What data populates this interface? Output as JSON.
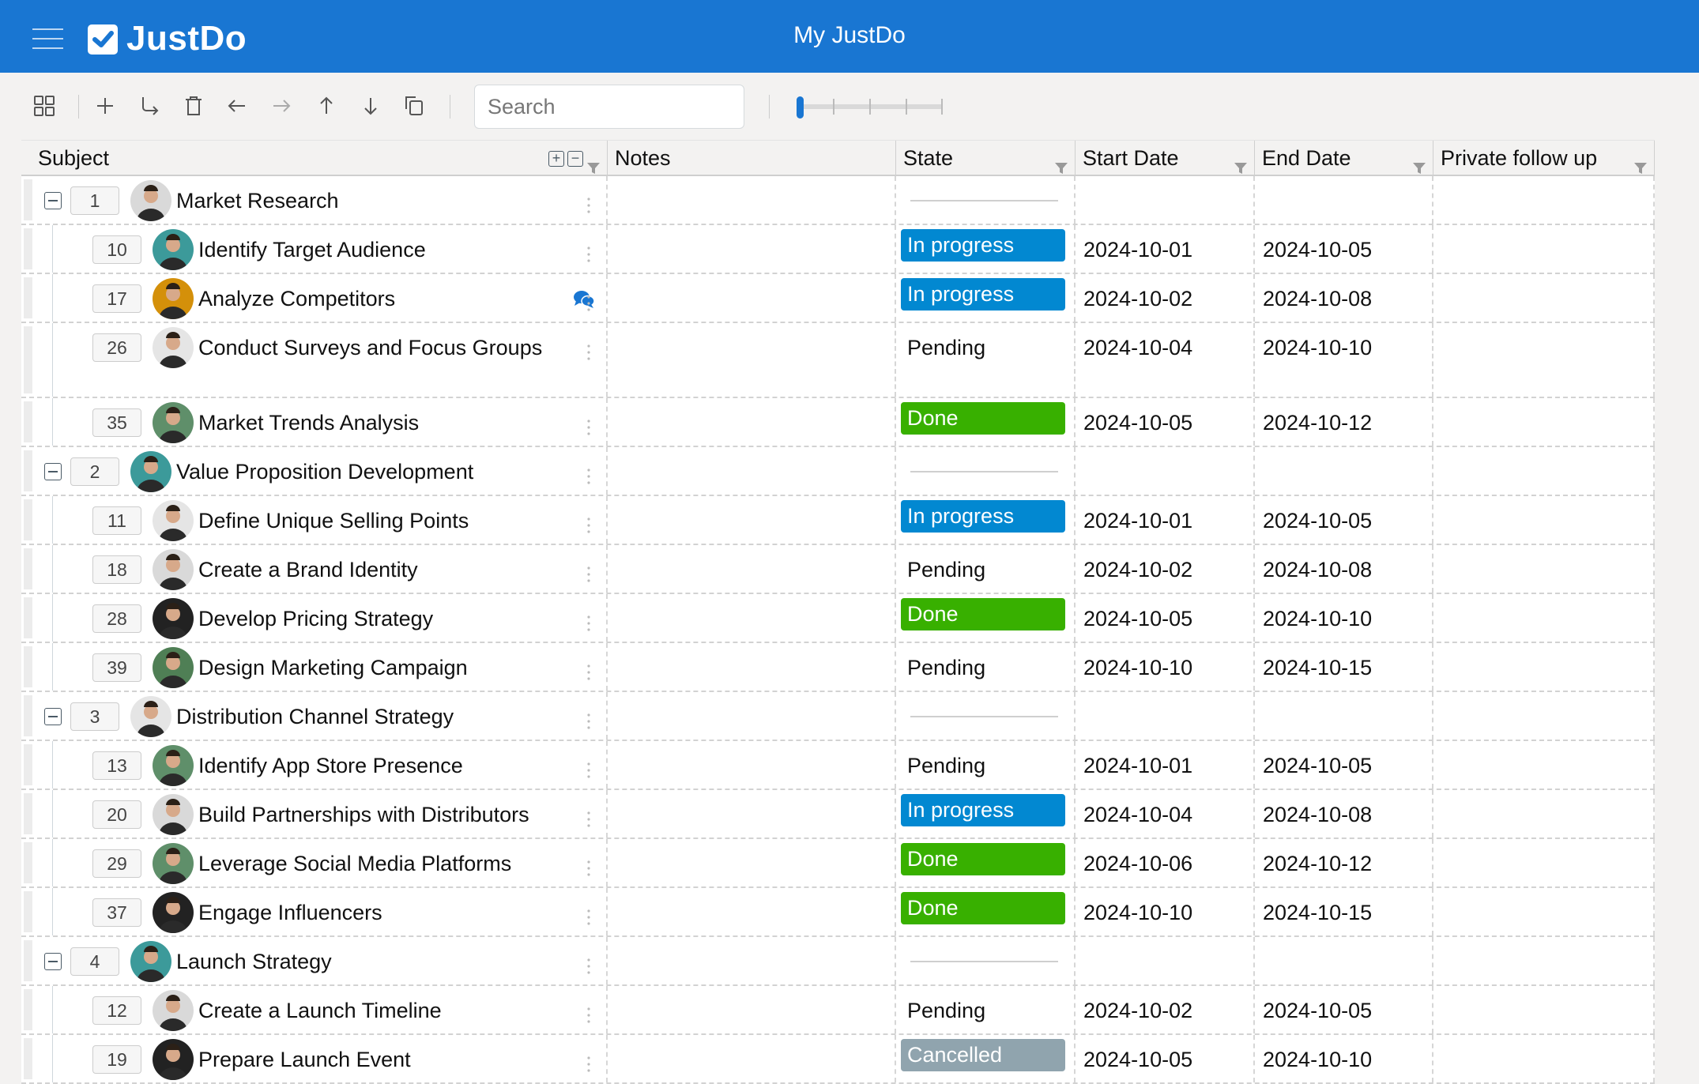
{
  "header": {
    "logo": "JustDo",
    "title": "My JustDo"
  },
  "toolbar": {
    "search_placeholder": "Search"
  },
  "columns": [
    "Subject",
    "Notes",
    "State",
    "Start Date",
    "End Date",
    "Private follow up"
  ],
  "colors": {
    "brand": "#1976d2",
    "In progress": "#0288d1",
    "Done": "#38b000",
    "Cancelled": "#90a4ae"
  },
  "rows": [
    {
      "id": "1",
      "subject": "Market Research",
      "parent": true,
      "avatar": "#d9d9d9"
    },
    {
      "id": "10",
      "subject": "Identify Target Audience",
      "state": "In progress",
      "start": "2024-10-01",
      "end": "2024-10-05",
      "avatar": "#3c9a9a"
    },
    {
      "id": "17",
      "subject": "Analyze Competitors",
      "state": "In progress",
      "start": "2024-10-02",
      "end": "2024-10-08",
      "avatar": "#d4900a",
      "chat": true
    },
    {
      "id": "26",
      "subject": "Conduct Surveys and Focus Groups",
      "state": "Pending",
      "start": "2024-10-04",
      "end": "2024-10-10",
      "avatar": "#e5e5e5",
      "tall": true
    },
    {
      "id": "35",
      "subject": "Market Trends Analysis",
      "state": "Done",
      "start": "2024-10-05",
      "end": "2024-10-12",
      "avatar": "#5f8f6a"
    },
    {
      "id": "2",
      "subject": "Value Proposition Development",
      "parent": true,
      "avatar": "#3c9a9a"
    },
    {
      "id": "11",
      "subject": "Define Unique Selling Points",
      "state": "In progress",
      "start": "2024-10-01",
      "end": "2024-10-05",
      "avatar": "#e5e5e5"
    },
    {
      "id": "18",
      "subject": "Create a Brand Identity",
      "state": "Pending",
      "start": "2024-10-02",
      "end": "2024-10-08",
      "avatar": "#d9d9d9"
    },
    {
      "id": "28",
      "subject": "Develop Pricing Strategy",
      "state": "Done",
      "start": "2024-10-05",
      "end": "2024-10-10",
      "avatar": "#222222"
    },
    {
      "id": "39",
      "subject": "Design Marketing Campaign",
      "state": "Pending",
      "start": "2024-10-10",
      "end": "2024-10-15",
      "avatar": "#4f7f55"
    },
    {
      "id": "3",
      "subject": "Distribution Channel Strategy",
      "parent": true,
      "avatar": "#e5e5e5"
    },
    {
      "id": "13",
      "subject": "Identify App Store Presence",
      "state": "Pending",
      "start": "2024-10-01",
      "end": "2024-10-05",
      "avatar": "#5f8f6a"
    },
    {
      "id": "20",
      "subject": "Build Partnerships with Distributors",
      "state": "In progress",
      "start": "2024-10-04",
      "end": "2024-10-08",
      "avatar": "#d9d9d9"
    },
    {
      "id": "29",
      "subject": "Leverage Social Media Platforms",
      "state": "Done",
      "start": "2024-10-06",
      "end": "2024-10-12",
      "avatar": "#5f8f6a"
    },
    {
      "id": "37",
      "subject": "Engage Influencers",
      "state": "Done",
      "start": "2024-10-10",
      "end": "2024-10-15",
      "avatar": "#222222"
    },
    {
      "id": "4",
      "subject": "Launch Strategy",
      "parent": true,
      "avatar": "#3c9a9a"
    },
    {
      "id": "12",
      "subject": "Create a Launch Timeline",
      "state": "Pending",
      "start": "2024-10-02",
      "end": "2024-10-05",
      "avatar": "#d9d9d9"
    },
    {
      "id": "19",
      "subject": "Prepare Launch Event",
      "state": "Cancelled",
      "start": "2024-10-05",
      "end": "2024-10-10",
      "avatar": "#222222"
    }
  ]
}
